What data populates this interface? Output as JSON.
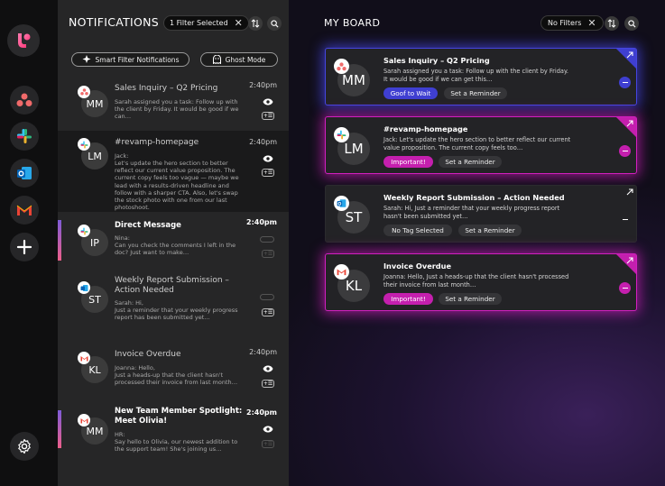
{
  "notifications_panel": {
    "title": "NOTIFICATIONS",
    "filter_chip": "1 Filter Selected",
    "smart_filter_label": "Smart Filter Notifications",
    "ghost_mode_label": "Ghost Mode",
    "items": [
      {
        "app": "asana",
        "initials": "MM",
        "title": "Sales Inquiry – Q2 Pricing",
        "sender": "",
        "body": "Sarah assigned you a task: Follow up with the client by Friday. It would be good if we can…",
        "time": "2:40pm",
        "read": true
      },
      {
        "app": "slack",
        "initials": "LM",
        "title": "#revamp-homepage",
        "sender": "Jack:",
        "body": "Let's update the hero section to better reflect our current value proposition. The current copy feels too vague — maybe we lead with a results-driven headline and follow with a sharper CTA. Also, let's swap the stock photo with one from our last photoshoot.",
        "time": "2:40pm",
        "read": true
      },
      {
        "app": "slack",
        "initials": "IP",
        "title": "Direct Message",
        "sender": "Nina:",
        "body": "Can you check the comments I left in the doc? Just want to make…",
        "time": "2:40pm",
        "read": false
      },
      {
        "app": "outlook",
        "initials": "ST",
        "title": "Weekly Report Submission – Action Needed",
        "sender": "Sarah: Hi,",
        "body": "Just a reminder that your weekly progress report has been submitted yet…",
        "time": "2:40pm",
        "read": true
      },
      {
        "app": "gmail",
        "initials": "KL",
        "title": "Invoice Overdue",
        "sender": "Joanna: Hello,",
        "body": "Just a heads-up that the client hasn't processed their invoice from last month…",
        "time": "2:40pm",
        "read": true
      },
      {
        "app": "gmail",
        "initials": "MM",
        "title": "New Team Member Spotlight: Meet Olivia!",
        "sender": "HR:",
        "body": "Say hello to Olivia, our newest addition to the support team! She's joining us…",
        "time": "2:40pm",
        "read": false
      }
    ]
  },
  "board": {
    "title": "MY BOARD",
    "filter_chip": "No Filters",
    "cards": [
      {
        "app": "asana",
        "initials": "MM",
        "title": "Sales Inquiry – Q2 Pricing",
        "body": "Sarah assigned you a task: Follow up with the client by Friday. It would be good if we can get this…",
        "tag": "Goof to Wait",
        "reminder": "Set a Reminder",
        "accent": "#3f3fd1"
      },
      {
        "app": "slack",
        "initials": "LM",
        "title": "#revamp-homepage",
        "body": "Jack: Let's update the hero section to better reflect our current value proposition. The current copy feels too…",
        "tag": "Important!",
        "reminder": "Set a Reminder",
        "accent": "#c41fae"
      },
      {
        "app": "outlook",
        "initials": "ST",
        "title": "Weekly Report Submission – Action Needed",
        "body": "Sarah: Hi, Just a reminder that your weekly progress report hasn't been submitted yet…",
        "tag": "No Tag Selected",
        "reminder": "Set a Reminder",
        "accent": "#ffffff"
      },
      {
        "app": "gmail",
        "initials": "KL",
        "title": "Invoice Overdue",
        "body": "Joanna: Hello, Just a heads-up that the client hasn't processed their invoice from last month…",
        "tag": "Important!",
        "reminder": "Set a Reminder",
        "accent": "#c41fae"
      }
    ]
  },
  "colors": {
    "important": "#c41fae",
    "wait": "#3f3fd1",
    "rail_bg": "#0f0f10",
    "panel_bg": "#262627"
  }
}
